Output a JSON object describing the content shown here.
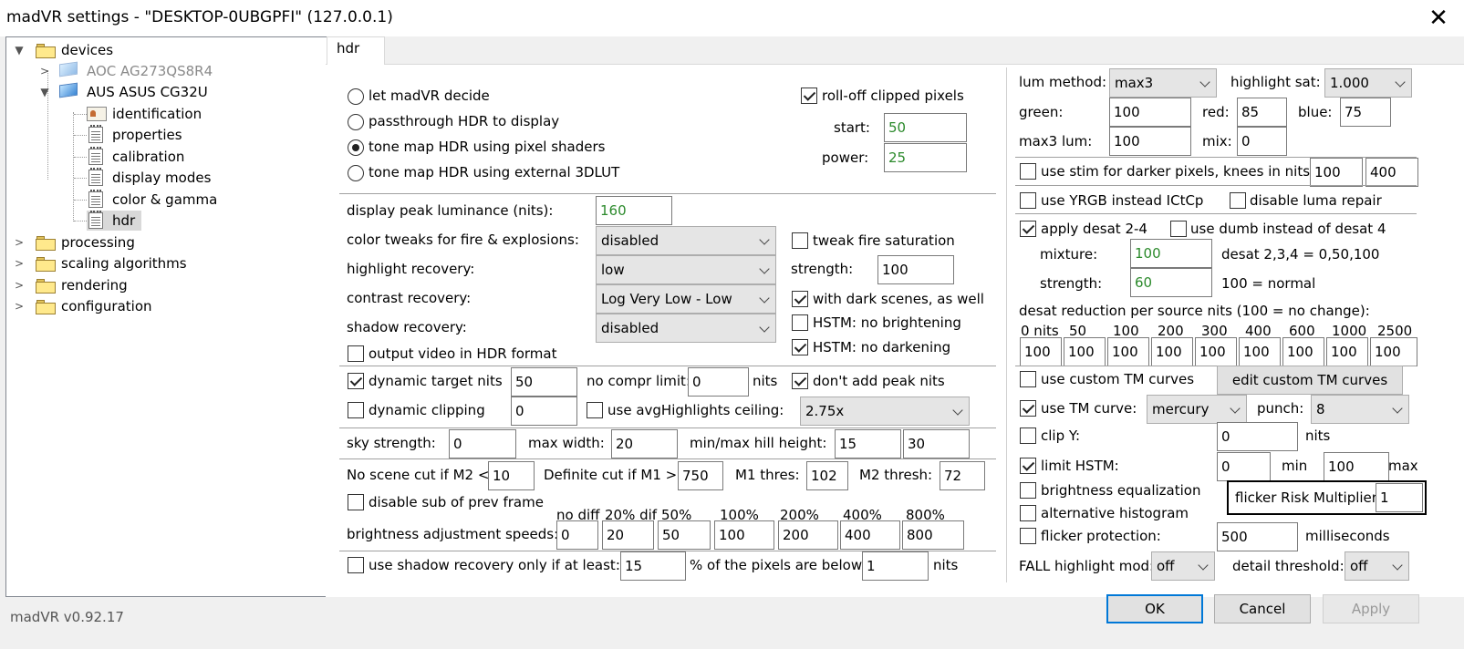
{
  "window": {
    "title": "madVR settings - \"DESKTOP-0UBGPFI\" (127.0.0.1)",
    "close_label": "✕"
  },
  "tree": {
    "devices": "devices",
    "aoc": "AOC AG273QS8R4",
    "asus": "AUS ASUS CG32U",
    "identification": "identification",
    "properties": "properties",
    "calibration": "calibration",
    "display_modes": "display modes",
    "color_gamma": "color & gamma",
    "hdr": "hdr",
    "processing": "processing",
    "scaling": "scaling algorithms",
    "rendering": "rendering",
    "configuration": "configuration"
  },
  "tab": {
    "label": "hdr"
  },
  "left": {
    "radios": [
      "let madVR decide",
      "passthrough HDR to display",
      "tone map HDR using pixel shaders",
      "tone map HDR using external 3DLUT"
    ],
    "rolloff_label": "roll-off clipped pixels",
    "start_label": "start:",
    "start_value": "50",
    "power_label": "power:",
    "power_value": "25",
    "peak_label": "display peak luminance (nits):",
    "peak_value": "160",
    "fire_label": "color tweaks for fire & explosions:",
    "fire_value": "disabled",
    "tweak_fire_label": "tweak fire saturation",
    "highlight_label": "highlight recovery:",
    "highlight_value": "low",
    "strength_label": "strength:",
    "strength_value": "100",
    "contrast_label": "contrast recovery:",
    "contrast_value": "Log Very Low - Low",
    "dark_scenes_label": "with dark scenes, as well",
    "shadow_label": "shadow recovery:",
    "shadow_value": "disabled",
    "hstm_bright_label": "HSTM: no brightening",
    "hstm_dark_label": "HSTM: no darkening",
    "output_hdr_label": "output video in HDR format",
    "dyn_target_label": "dynamic target nits",
    "dyn_target_value": "50",
    "no_compr_label": "no compr limit:",
    "no_compr_value": "0",
    "nits_unit": "nits",
    "dont_add_label": "don't add peak nits",
    "dyn_clip_label": "dynamic clipping",
    "dyn_clip_value": "0",
    "avg_ceiling_label": "use avgHighlights ceiling:",
    "avg_ceiling_value": "2.75x",
    "sky_label": "sky strength:",
    "sky_value": "0",
    "maxw_label": "max width:",
    "maxw_value": "20",
    "hill_label": "min/max hill height:",
    "hill_min": "15",
    "hill_max": "30",
    "noscene_label": "No scene cut if M2 <",
    "noscene_value": "10",
    "defcut_label": "Definite cut if M1 >",
    "defcut_value": "750",
    "m1_label": "M1 thres:",
    "m1_value": "102",
    "m2_label": "M2 thresh:",
    "m2_value": "72",
    "disable_sub_label": "disable sub of prev frame",
    "speed_headers": [
      "no diff",
      "20% dif",
      "50%",
      "100%",
      "200%",
      "400%",
      "800%"
    ],
    "speeds_label": "brightness adjustment speeds:",
    "speeds": [
      "0",
      "20",
      "50",
      "100",
      "200",
      "400",
      "800"
    ],
    "shadow_only_label": "use shadow recovery only if at least:",
    "shadow_only_value": "15",
    "pixels_below_label": "% of the pixels are below",
    "pixels_below_value": "1",
    "nits_unit2": "nits"
  },
  "right": {
    "lum_label": "lum method:",
    "lum_value": "max3",
    "hsat_label": "highlight sat:",
    "hsat_value": "1.000",
    "green_label": "green:",
    "green_value": "100",
    "red_label": "red:",
    "red_value": "85",
    "blue_label": "blue:",
    "blue_value": "75",
    "max3_label": "max3 lum:",
    "max3_value": "100",
    "mix_label": "mix:",
    "mix_value": "0",
    "stim_label": "use stim for darker pixels, knees in nits:",
    "stim_a": "100",
    "stim_b": "400",
    "yrgb_label": "use YRGB instead ICtCp",
    "luma_label": "disable luma repair",
    "desat_label": "apply desat 2-4",
    "dumb_label": "use dumb instead of desat 4",
    "mixture_label": "mixture:",
    "mixture_value": "100",
    "desat_note": "desat 2,3,4 = 0,50,100",
    "dstrength_label": "strength:",
    "dstrength_value": "60",
    "normal_note": "100 = normal",
    "reduction_label": "desat reduction per source nits (100 = no change):",
    "nits_headers": [
      "0 nits",
      "50",
      "100",
      "200",
      "300",
      "400",
      "600",
      "1000",
      "2500"
    ],
    "nits_values": [
      "100",
      "100",
      "100",
      "100",
      "100",
      "100",
      "100",
      "100",
      "100"
    ],
    "custom_tm_label": "use custom TM curves",
    "edit_tm_label": "edit custom TM curves",
    "tm_curve_label": "use TM curve:",
    "tm_curve_value": "mercury",
    "punch_label": "punch:",
    "punch_value": "8",
    "clipy_label": "clip Y:",
    "clipy_value": "0",
    "clipy_unit": "nits",
    "limit_hstm_label": "limit HSTM:",
    "limit_min_value": "0",
    "min_label": "min",
    "limit_max_value": "100",
    "max_label": "max",
    "brightness_eq_label": "brightness equalization",
    "alt_hist_label": "alternative histogram",
    "flicker_risk_label": "flicker Risk Multiplier:",
    "flicker_risk_value": "1",
    "flicker_prot_label": "flicker protection:",
    "flicker_prot_value": "500",
    "ms_label": "milliseconds",
    "fall_label": "FALL highlight mod:",
    "fall_value": "off",
    "detail_label": "detail threshold:",
    "detail_value": "off"
  },
  "footer": {
    "version": "madVR v0.92.17",
    "ok": "OK",
    "cancel": "Cancel",
    "apply": "Apply"
  }
}
